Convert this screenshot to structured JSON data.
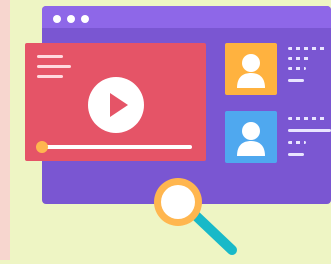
{
  "illustration": {
    "colors": {
      "background": "#eef5c4",
      "window": "#7a56d2",
      "titlebar": "#8e67e8",
      "video_card": "#e55467",
      "avatar_1": "#ffb23f",
      "avatar_2": "#4fa8ef",
      "progress_knob": "#ffb64f",
      "magnifier_ring": "#ffb64f",
      "magnifier_handle": "#18b9c8"
    },
    "video_player": {
      "progress": 0
    },
    "icons": [
      "play-icon",
      "user-avatar-icon",
      "magnifier-icon"
    ]
  }
}
